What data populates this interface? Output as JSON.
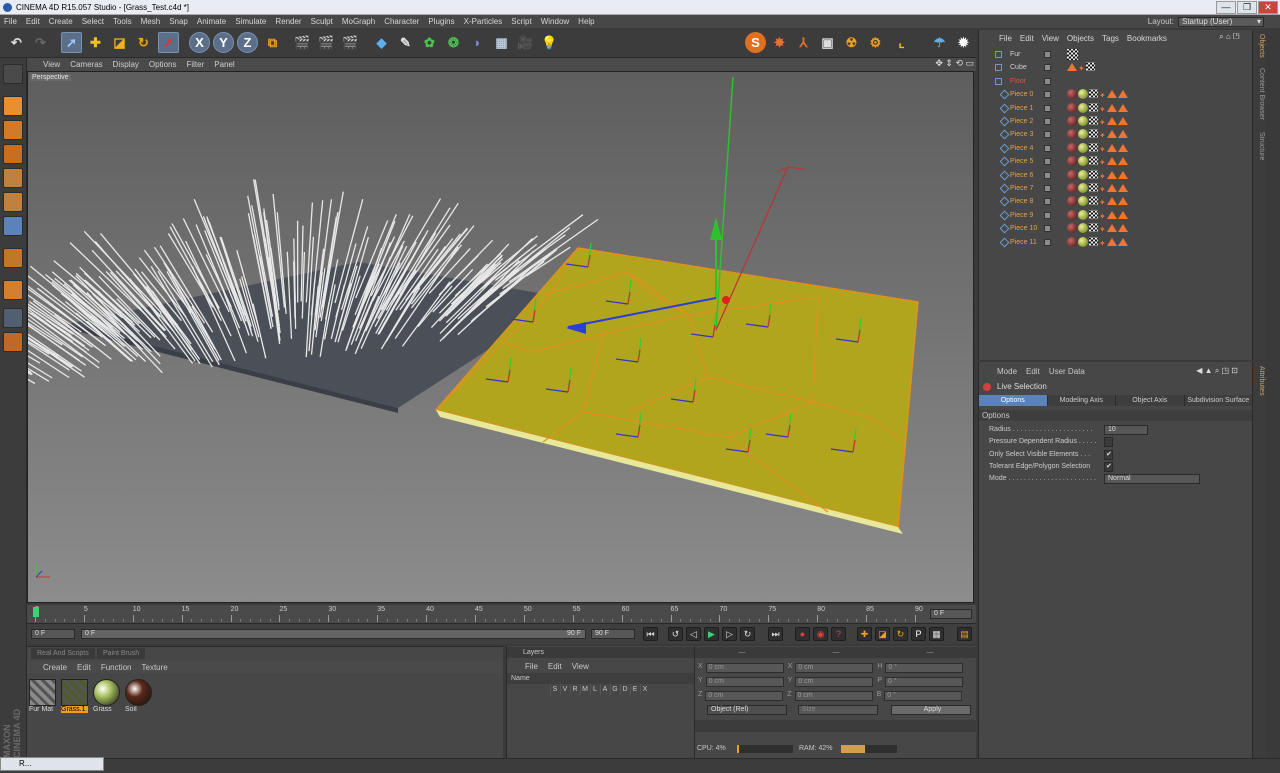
{
  "window": {
    "title": "CINEMA 4D R15.057 Studio - [Grass_Test.c4d *]",
    "min": "—",
    "max": "❐",
    "close": "✕"
  },
  "menubar": [
    "File",
    "Edit",
    "Create",
    "Select",
    "Tools",
    "Mesh",
    "Snap",
    "Animate",
    "Simulate",
    "Render",
    "Sculpt",
    "MoGraph",
    "Character",
    "Plugins",
    "X-Particles",
    "Script",
    "Window",
    "Help"
  ],
  "layout": {
    "label": "Layout:",
    "value": "Startup (User)"
  },
  "toolbar": {
    "x_label": "X",
    "y_label": "Y",
    "z_label": "Z"
  },
  "viewport": {
    "menu": [
      "View",
      "Cameras",
      "Display",
      "Options",
      "Filter",
      "Panel"
    ],
    "label": "Perspective"
  },
  "timeline": {
    "ticks": [
      "0",
      "5",
      "10",
      "15",
      "20",
      "25",
      "30",
      "35",
      "40",
      "45",
      "50",
      "55",
      "60",
      "65",
      "70",
      "75",
      "80",
      "85",
      "90"
    ],
    "current": "0 F",
    "start": "0 F",
    "range_start": "0 F",
    "range_end": "90 F",
    "end": "90 F"
  },
  "materials": {
    "tabs": [
      "Real And Scripts",
      "Paint Brush"
    ],
    "menu": [
      "Create",
      "Edit",
      "Function",
      "Texture"
    ],
    "items": [
      {
        "name": "Fur Mat",
        "color": "#8a8a8a"
      },
      {
        "name": "Grass.1",
        "color": "#4e5a2c"
      },
      {
        "name": "Grass",
        "color": "#a8c060"
      },
      {
        "name": "Soil",
        "color": "#5a2818"
      }
    ]
  },
  "layers": {
    "title": "Layers",
    "menu": [
      "File",
      "Edit",
      "View"
    ],
    "name_col": "Name",
    "cols": [
      "S",
      "V",
      "R",
      "M",
      "L",
      "A",
      "G",
      "D",
      "E",
      "X"
    ]
  },
  "coords": {
    "header": [
      "—",
      "—",
      "—"
    ],
    "rows": [
      {
        "a": "X",
        "av": "0 cm",
        "b": "X",
        "bv": "0 cm",
        "c": "H",
        "cv": "0 °"
      },
      {
        "a": "Y",
        "av": "0 cm",
        "b": "Y",
        "bv": "0 cm",
        "c": "P",
        "cv": "0 °"
      },
      {
        "a": "Z",
        "av": "0 cm",
        "b": "Z",
        "bv": "0 cm",
        "c": "B",
        "cv": "0 °"
      }
    ],
    "mode": "Object (Rel)",
    "size": "Size",
    "apply": "Apply"
  },
  "status": {
    "cpu": "CPU: 4%",
    "ram": "RAM: 42%",
    "cpu_pct": 4,
    "ram_pct": 42
  },
  "objects": {
    "menu": [
      "File",
      "Edit",
      "View",
      "Objects",
      "Tags",
      "Bookmarks"
    ],
    "rows": [
      {
        "name": "Fur",
        "depth": 0,
        "color": "white"
      },
      {
        "name": "Cube",
        "depth": 0,
        "color": "white"
      },
      {
        "name": "Floor",
        "depth": 0,
        "color": "red"
      },
      {
        "name": "Piece 0",
        "depth": 1,
        "color": "orange"
      },
      {
        "name": "Piece 1",
        "depth": 1,
        "color": "orange"
      },
      {
        "name": "Piece 2",
        "depth": 1,
        "color": "orange"
      },
      {
        "name": "Piece 3",
        "depth": 1,
        "color": "orange"
      },
      {
        "name": "Piece 4",
        "depth": 1,
        "color": "orange"
      },
      {
        "name": "Piece 5",
        "depth": 1,
        "color": "orange"
      },
      {
        "name": "Piece 6",
        "depth": 1,
        "color": "orange"
      },
      {
        "name": "Piece 7",
        "depth": 1,
        "color": "orange"
      },
      {
        "name": "Piece 8",
        "depth": 1,
        "color": "orange"
      },
      {
        "name": "Piece 9",
        "depth": 1,
        "color": "orange"
      },
      {
        "name": "Piece 10",
        "depth": 1,
        "color": "orange"
      },
      {
        "name": "Piece 11",
        "depth": 1,
        "color": "orange"
      }
    ]
  },
  "side_tabs_obj": [
    "Objects",
    "Content Browser",
    "Structure"
  ],
  "side_tabs_attr": [
    "Attributes"
  ],
  "attributes": {
    "menu": [
      "Mode",
      "Edit",
      "User Data"
    ],
    "tool": "Live Selection",
    "tabs": [
      "Options",
      "Modeling Axis",
      "Object Axis",
      "Subdivision Surface"
    ],
    "section": "Options",
    "rows": [
      {
        "label": "Radius . . . . . . . . . . . . . . . . . . . . .",
        "value": "10"
      },
      {
        "label": "Pressure Dependent Radius . . . . .",
        "value": ""
      },
      {
        "label": "Only Select Visible Elements . . .",
        "value": "✔"
      },
      {
        "label": "Tolerant Edge/Polygon Selection",
        "value": "✔"
      },
      {
        "label": "Mode . . . . . . . . . . . . . . . . . . . . . . .",
        "value": "Normal"
      }
    ]
  },
  "branding": "MAXON CINEMA 4D",
  "taskbar": {
    "item": "R..."
  }
}
